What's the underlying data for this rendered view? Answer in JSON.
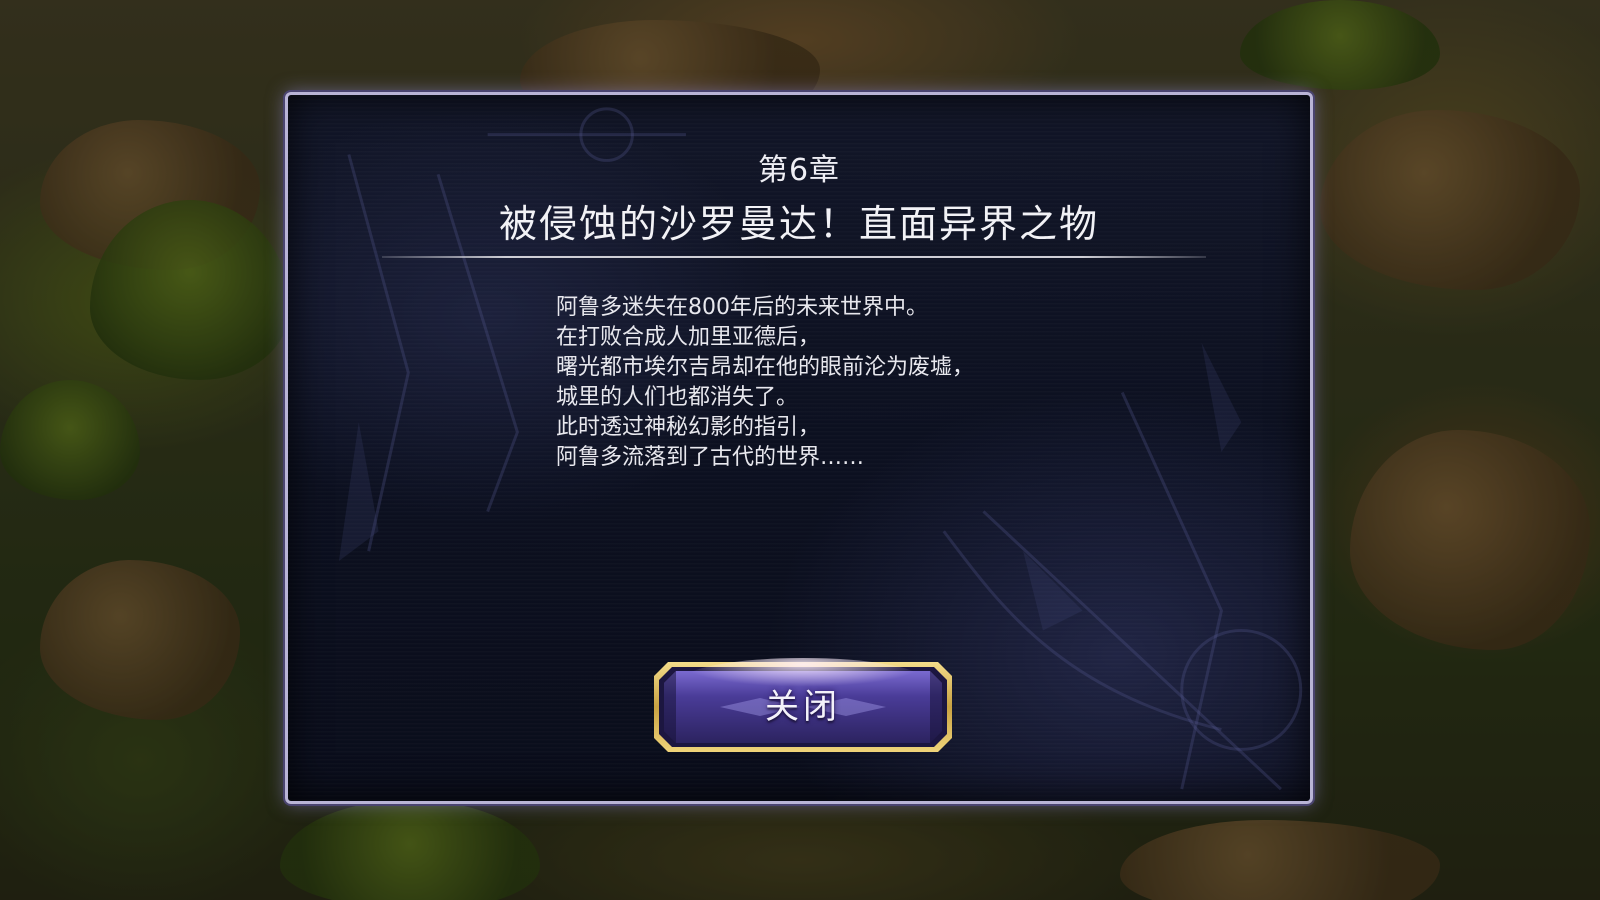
{
  "dialog": {
    "chapter": "第6章",
    "title": "被侵蚀的沙罗曼达！直面异界之物",
    "body_lines": [
      "阿鲁多迷失在800年后的未来世界中。",
      "在打败合成人加里亚德后，",
      "曙光都市埃尔吉昂却在他的眼前沦为废墟，",
      "城里的人们也都消失了。",
      "此时透过神秘幻影的指引，",
      "阿鲁多流落到了古代的世界……"
    ],
    "close_label": "关闭"
  },
  "colors": {
    "panel_border": "#b9b4d6",
    "panel_bg": "#0c1020",
    "button_gold": "#d8b85a",
    "button_purple": "#5b4aa8"
  }
}
